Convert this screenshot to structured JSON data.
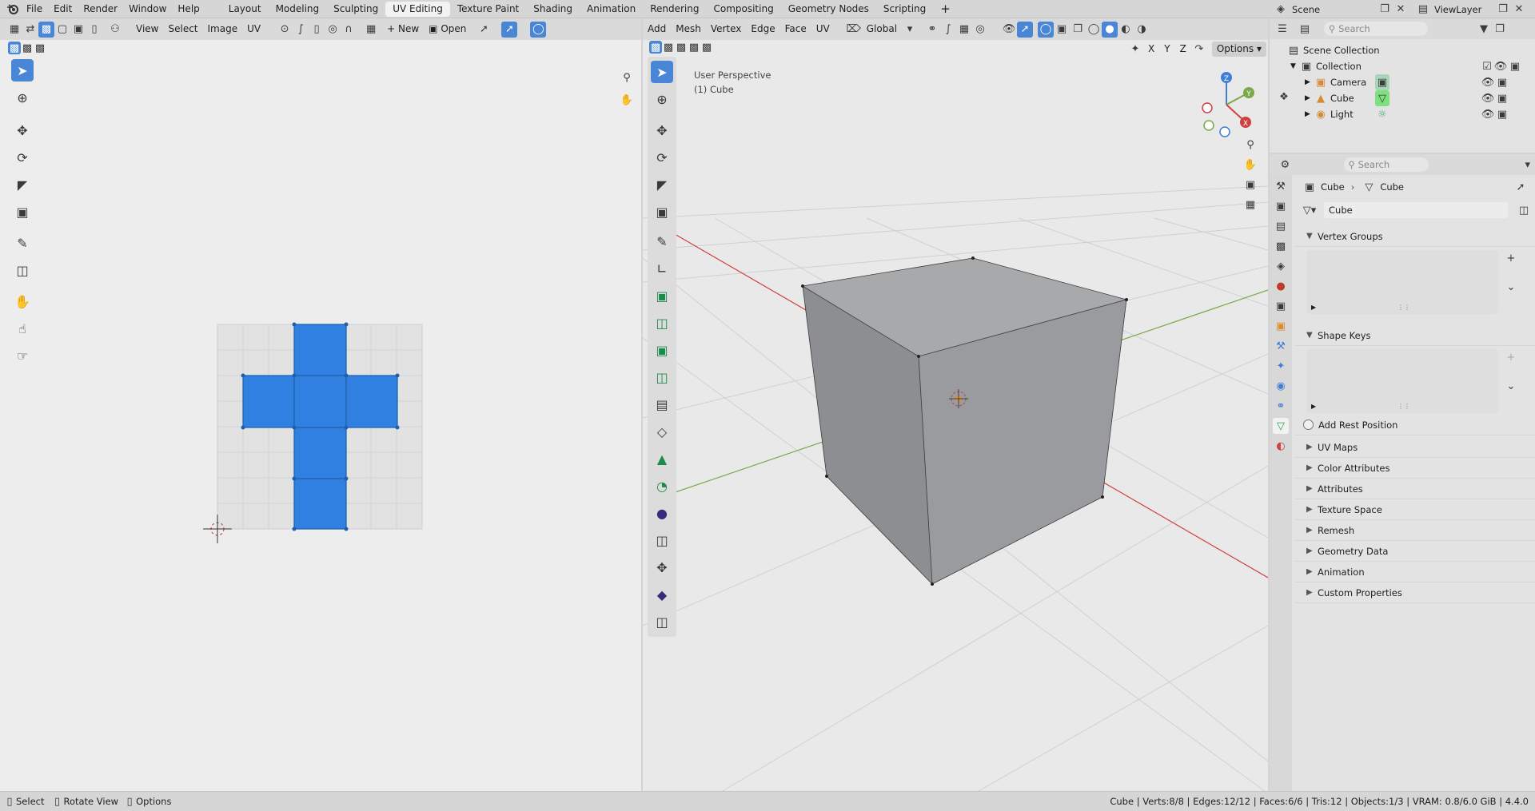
{
  "topbar": {
    "menus": [
      "File",
      "Edit",
      "Render",
      "Window",
      "Help"
    ],
    "workspaces": [
      "Layout",
      "Modeling",
      "Sculpting",
      "UV Editing",
      "Texture Paint",
      "Shading",
      "Animation",
      "Rendering",
      "Compositing",
      "Geometry Nodes",
      "Scripting"
    ],
    "active_workspace": "UV Editing",
    "add_workspace": "+",
    "scene": "Scene",
    "view_layer": "ViewLayer"
  },
  "uv_editor": {
    "menus": [
      "View",
      "Select",
      "Image",
      "UV"
    ],
    "new_label": "New",
    "open_label": "Open"
  },
  "viewport": {
    "menus": [
      "Add",
      "Mesh",
      "Vertex",
      "Edge",
      "Face",
      "UV"
    ],
    "transform_orientation": "Global",
    "axes": [
      "X",
      "Y",
      "Z"
    ],
    "options_label": "Options",
    "perspective_label": "User Perspective",
    "object_label": "(1) Cube",
    "gizmo_axes": [
      "Z",
      "Y",
      "X"
    ]
  },
  "outliner": {
    "search_placeholder": "Search",
    "scene_collection": "Scene Collection",
    "collection": "Collection",
    "items": [
      "Camera",
      "Cube",
      "Light"
    ]
  },
  "properties": {
    "search_placeholder": "Search",
    "breadcrumb_object": "Cube",
    "breadcrumb_data": "Cube",
    "mesh_name": "Cube",
    "sections_open": [
      "Vertex Groups",
      "Shape Keys"
    ],
    "add_rest_position": "Add Rest Position",
    "sections_closed": [
      "UV Maps",
      "Color Attributes",
      "Attributes",
      "Texture Space",
      "Remesh",
      "Geometry Data",
      "Animation",
      "Custom Properties"
    ]
  },
  "status": {
    "select": "Select",
    "rotate": "Rotate View",
    "options": "Options",
    "stats": "Cube | Verts:8/8 | Edges:12/12 | Faces:6/6 | Tris:12 | Objects:1/3 | VRAM: 0.8/6.0 GiB | 4.4.0"
  },
  "colors": {
    "accent": "#4a86d6",
    "uv_face": "#2f80e0",
    "x_axis": "#d04040",
    "y_axis": "#7aa84a",
    "z_axis": "#3f7fd6"
  }
}
